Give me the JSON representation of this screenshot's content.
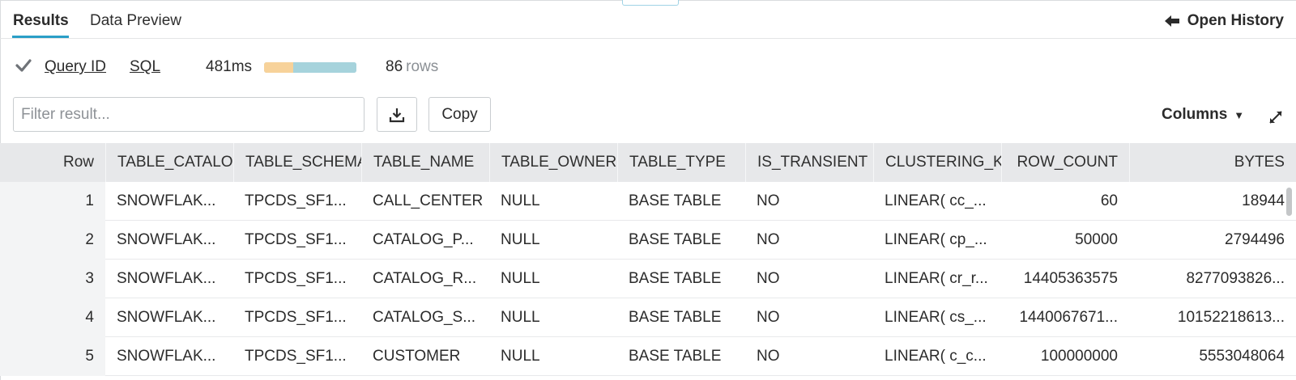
{
  "tabs": {
    "results_label": "Results",
    "data_preview_label": "Data Preview",
    "open_history_label": "Open History"
  },
  "status": {
    "query_id_label": "Query ID",
    "sql_label": "SQL",
    "duration": "481ms",
    "progress_segments": {
      "queued_fraction": 0.32,
      "execution_fraction": 0.68
    },
    "row_count": "86",
    "row_unit": "rows"
  },
  "toolbar": {
    "filter_placeholder": "Filter result...",
    "filter_value": "",
    "copy_label": "Copy",
    "columns_label": "Columns",
    "columns_caret": "▼"
  },
  "table": {
    "columns": [
      "Row",
      "TABLE_CATALOG",
      "TABLE_SCHEMA",
      "TABLE_NAME",
      "TABLE_OWNER",
      "TABLE_TYPE",
      "IS_TRANSIENT",
      "CLUSTERING_KEY",
      "ROW_COUNT",
      "BYTES"
    ],
    "rows": [
      [
        "1",
        "SNOWFLAK...",
        "TPCDS_SF1...",
        "CALL_CENTER",
        "NULL",
        "BASE TABLE",
        "NO",
        "LINEAR( cc_...",
        "60",
        "18944"
      ],
      [
        "2",
        "SNOWFLAK...",
        "TPCDS_SF1...",
        "CATALOG_P...",
        "NULL",
        "BASE TABLE",
        "NO",
        "LINEAR( cp_...",
        "50000",
        "2794496"
      ],
      [
        "3",
        "SNOWFLAK...",
        "TPCDS_SF1...",
        "CATALOG_R...",
        "NULL",
        "BASE TABLE",
        "NO",
        "LINEAR( cr_r...",
        "14405363575",
        "8277093826..."
      ],
      [
        "4",
        "SNOWFLAK...",
        "TPCDS_SF1...",
        "CATALOG_S...",
        "NULL",
        "BASE TABLE",
        "NO",
        "LINEAR( cs_...",
        "1440067671...",
        "10152218613..."
      ],
      [
        "5",
        "SNOWFLAK...",
        "TPCDS_SF1...",
        "CUSTOMER",
        "NULL",
        "BASE TABLE",
        "NO",
        "LINEAR( c_c...",
        "100000000",
        "5553048064"
      ]
    ]
  },
  "icons": {
    "status": "check-icon",
    "history": "arrow-left-icon",
    "download": "download-icon",
    "expand": "expand-icon"
  },
  "colors": {
    "accent": "#2a9fc7",
    "progress_queued": "#f7d29a",
    "progress_exec": "#a6d3dc",
    "header_bg": "#e7e8ea",
    "check": "#6f7378"
  }
}
